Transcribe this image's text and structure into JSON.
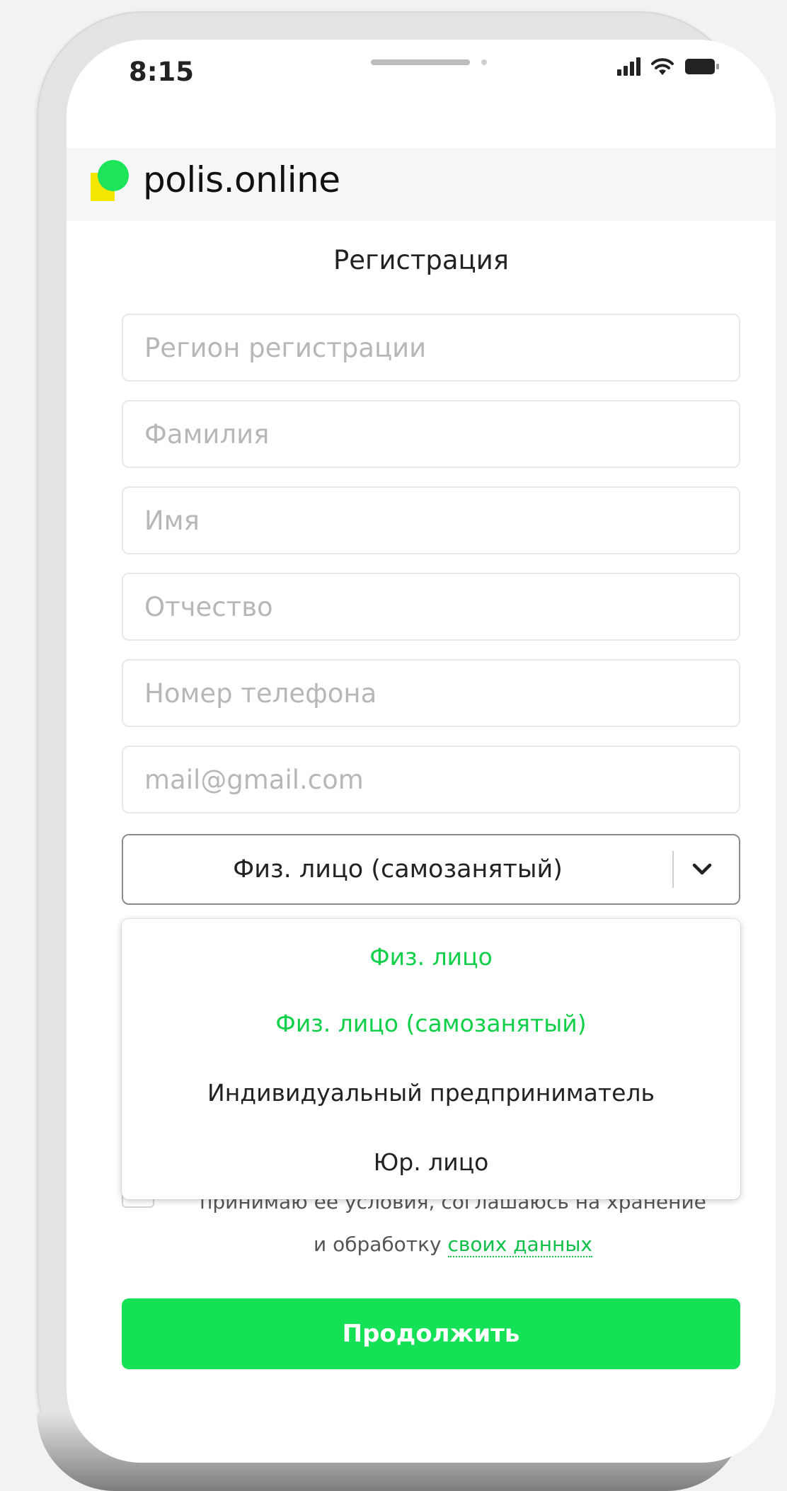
{
  "status_bar": {
    "time": "8:15"
  },
  "header": {
    "logo_text": "polis.online"
  },
  "page_title": "Регистрация",
  "fields": {
    "region": {
      "placeholder": "Регион регистрации",
      "value": ""
    },
    "last_name": {
      "placeholder": "Фамилия",
      "value": ""
    },
    "first_name": {
      "placeholder": "Имя",
      "value": ""
    },
    "patronymic": {
      "placeholder": "Отчество",
      "value": ""
    },
    "phone": {
      "placeholder": "Номер телефона",
      "value": ""
    },
    "email": {
      "placeholder": "mail@gmail.com",
      "value": ""
    }
  },
  "entity_type": {
    "selected": "Физ. лицо (самозанятый)",
    "options": [
      {
        "label": "Физ. лицо",
        "highlighted": true
      },
      {
        "label": "Физ. лицо (самозанятый)",
        "highlighted": true
      },
      {
        "label": "Индивидуальный предприниматель",
        "highlighted": false
      },
      {
        "label": "Юр. лицо",
        "highlighted": false
      }
    ]
  },
  "agreement": {
    "checked": false,
    "text_line1": "принимаю ее условия, соглашаюсь на хранение",
    "text_line2_prefix": "и обработку ",
    "link_text": "своих данных"
  },
  "continue_button": "Продолжить",
  "colors": {
    "accent_green": "#14e156",
    "option_green": "#10d04a",
    "logo_yellow": "#f3e600",
    "logo_green": "#1ee35b"
  }
}
